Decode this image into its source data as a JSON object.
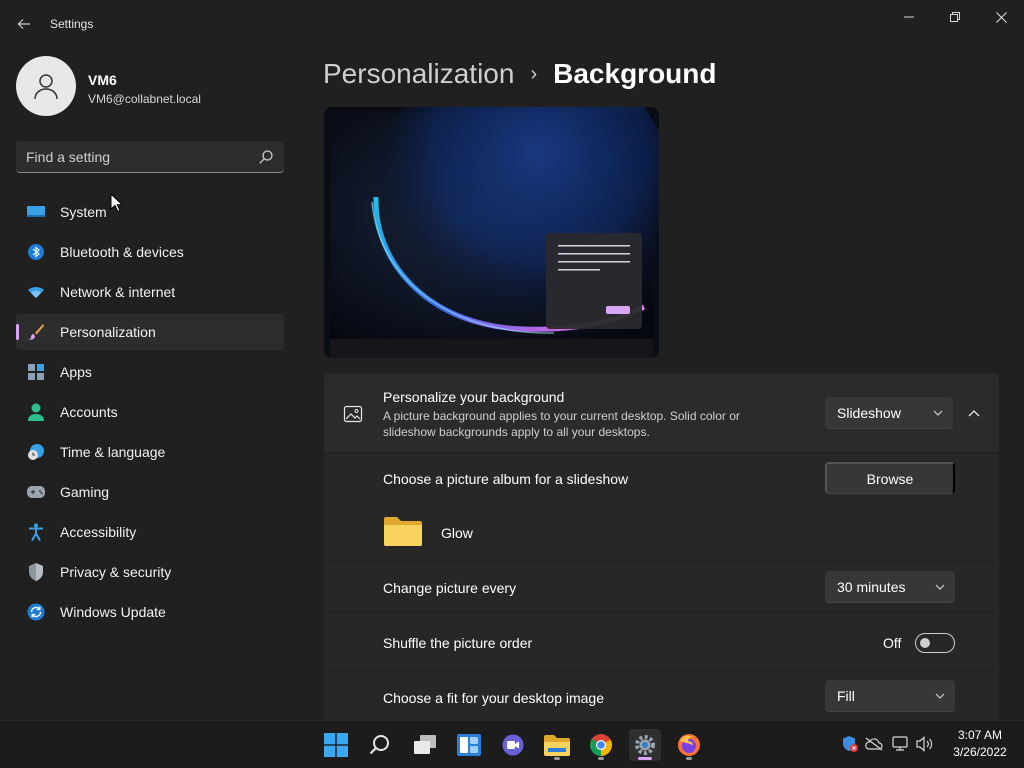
{
  "window": {
    "title": "Settings"
  },
  "profile": {
    "name": "VM6",
    "email": "VM6@collabnet.local"
  },
  "search": {
    "placeholder": "Find a setting"
  },
  "sidebar": {
    "items": [
      {
        "label": "System",
        "icon": "system-icon"
      },
      {
        "label": "Bluetooth & devices",
        "icon": "bluetooth-icon"
      },
      {
        "label": "Network & internet",
        "icon": "wifi-icon"
      },
      {
        "label": "Personalization",
        "icon": "brush-icon",
        "selected": true
      },
      {
        "label": "Apps",
        "icon": "apps-icon"
      },
      {
        "label": "Accounts",
        "icon": "person-icon"
      },
      {
        "label": "Time & language",
        "icon": "clock-globe-icon"
      },
      {
        "label": "Gaming",
        "icon": "gamepad-icon"
      },
      {
        "label": "Accessibility",
        "icon": "accessibility-icon"
      },
      {
        "label": "Privacy & security",
        "icon": "shield-icon"
      },
      {
        "label": "Windows Update",
        "icon": "update-icon"
      }
    ],
    "accent": "#d9a5f5"
  },
  "breadcrumb": {
    "parent": "Personalization",
    "separator": "›",
    "current": "Background"
  },
  "background": {
    "title": "Personalize your background",
    "description": "A picture background applies to your current desktop. Solid color or slideshow backgrounds apply to all your desktops.",
    "type_value": "Slideshow",
    "album_label": "Choose a picture album for a slideshow",
    "browse_label": "Browse",
    "album_name": "Glow",
    "interval_label": "Change picture every",
    "interval_value": "30 minutes",
    "shuffle_label": "Shuffle the picture order",
    "shuffle_state": "Off",
    "fit_label": "Choose a fit for your desktop image",
    "fit_value": "Fill"
  },
  "taskbar": {
    "apps": [
      "start-icon",
      "search-icon",
      "task-view-icon",
      "widgets-icon",
      "chat-icon",
      "file-explorer-icon",
      "chrome-icon",
      "settings-icon",
      "firefox-icon"
    ],
    "time": "3:07 AM",
    "date": "3/26/2022"
  }
}
